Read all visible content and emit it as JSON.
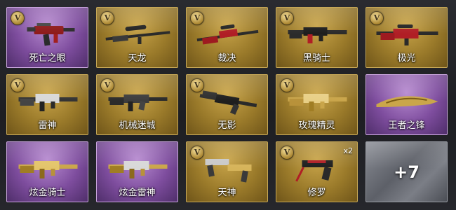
{
  "badge_letter": "V",
  "items": [
    {
      "name": "死亡之眼",
      "rarity": "purple",
      "badge": true,
      "icon": "smg-icon"
    },
    {
      "name": "天龙",
      "rarity": "gold",
      "badge": true,
      "icon": "sniper-rifle-icon"
    },
    {
      "name": "裁决",
      "rarity": "gold",
      "badge": true,
      "icon": "sniper-rifle-icon"
    },
    {
      "name": "黑骑士",
      "rarity": "gold",
      "badge": true,
      "icon": "assault-rifle-icon"
    },
    {
      "name": "极光",
      "rarity": "gold",
      "badge": true,
      "icon": "sniper-rifle-icon"
    },
    {
      "name": "雷神",
      "rarity": "gold",
      "badge": true,
      "icon": "assault-rifle-icon"
    },
    {
      "name": "机械迷城",
      "rarity": "gold",
      "badge": true,
      "icon": "assault-rifle-icon"
    },
    {
      "name": "无影",
      "rarity": "gold",
      "badge": true,
      "icon": "assault-rifle-icon"
    },
    {
      "name": "玫瑰精灵",
      "rarity": "gold",
      "badge": true,
      "icon": "assault-rifle-icon"
    },
    {
      "name": "王者之锋",
      "rarity": "purple",
      "badge": false,
      "icon": "knife-icon"
    },
    {
      "name": "炫金骑士",
      "rarity": "purple",
      "badge": false,
      "icon": "assault-rifle-icon"
    },
    {
      "name": "炫金雷神",
      "rarity": "purple",
      "badge": false,
      "icon": "assault-rifle-icon"
    },
    {
      "name": "天神",
      "rarity": "gold",
      "badge": true,
      "icon": "dual-pistols-icon"
    },
    {
      "name": "修罗",
      "rarity": "gold",
      "badge": true,
      "icon": "pistol-icon",
      "count": "x2"
    }
  ],
  "more_label": "+7",
  "colors": {
    "gold": "#a8862f",
    "purple": "#7e4d9e",
    "grey": "#6a6d74"
  }
}
